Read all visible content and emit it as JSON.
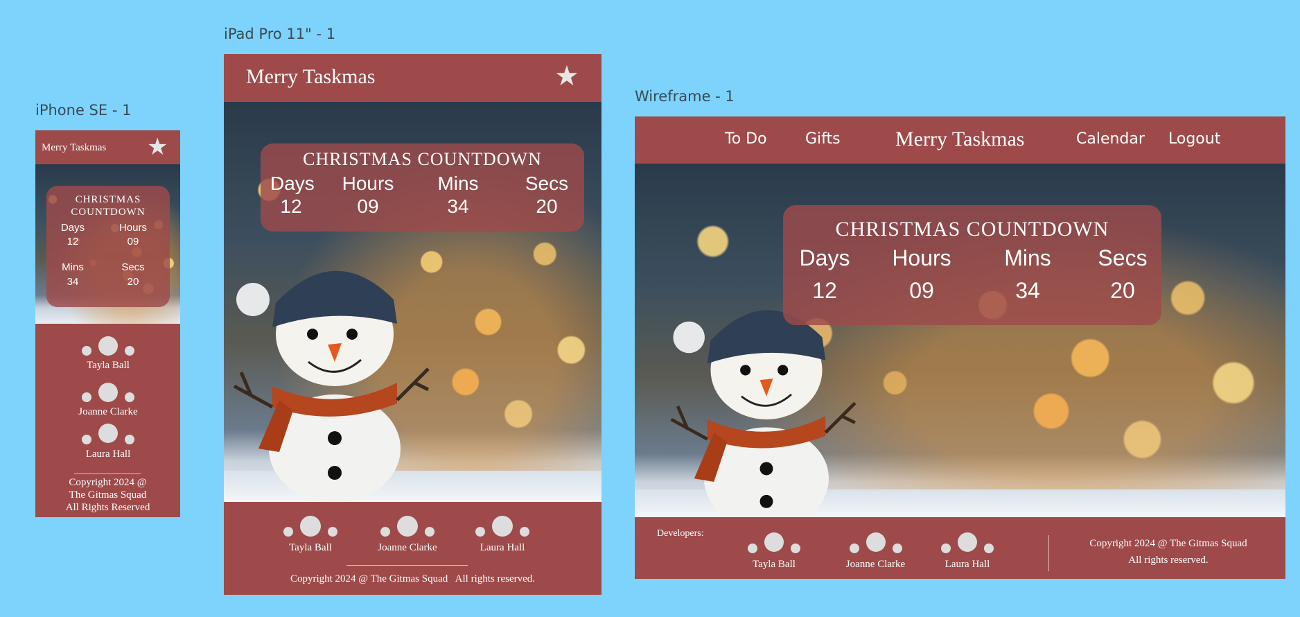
{
  "labels": {
    "iphone": "iPhone SE - 1",
    "ipad": "iPad Pro 11\" - 1",
    "wireframe": "Wireframe - 1"
  },
  "app": {
    "title": "Merry Taskmas",
    "favorite_icon": "star-icon"
  },
  "nav": {
    "todo": "To Do",
    "gifts": "Gifts",
    "calendar": "Calendar",
    "logout": "Logout"
  },
  "countdown": {
    "title": "CHRISTMAS COUNTDOWN",
    "title_line1": "CHRISTMAS",
    "title_line2": "COUNTDOWN",
    "units": [
      {
        "label": "Days",
        "value": "12"
      },
      {
        "label": "Hours",
        "value": "09"
      },
      {
        "label": "Mins",
        "value": "34"
      },
      {
        "label": "Secs",
        "value": "20"
      }
    ]
  },
  "footer": {
    "developers_label": "Developers:",
    "developers": [
      "Tayla Ball",
      "Joanne Clarke",
      "Laura Hall"
    ],
    "copyright_ipad": "Copyright 2024 @ The Gitmas Squad   All rights reserved.",
    "copyright_wide_1": "Copyright 2024 @ The Gitmas Squad",
    "copyright_wide_2": "All rights reserved.",
    "copyright_phone_1": "Copyright 2024 @",
    "copyright_phone_2": "The Gitmas Squad",
    "copyright_phone_3": "All Rights Reserved"
  },
  "colors": {
    "canvas": "#7dd3fb",
    "brand": "#9e4a4a",
    "text": "#ffffff"
  }
}
